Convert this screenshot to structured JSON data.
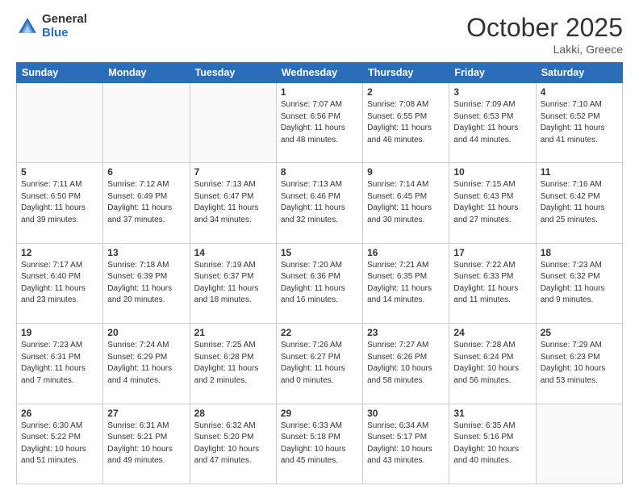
{
  "logo": {
    "general": "General",
    "blue": "Blue"
  },
  "header": {
    "month": "October 2025",
    "location": "Lakki, Greece"
  },
  "weekdays": [
    "Sunday",
    "Monday",
    "Tuesday",
    "Wednesday",
    "Thursday",
    "Friday",
    "Saturday"
  ],
  "weeks": [
    [
      {
        "day": "",
        "info": ""
      },
      {
        "day": "",
        "info": ""
      },
      {
        "day": "",
        "info": ""
      },
      {
        "day": "1",
        "info": "Sunrise: 7:07 AM\nSunset: 6:56 PM\nDaylight: 11 hours and 48 minutes."
      },
      {
        "day": "2",
        "info": "Sunrise: 7:08 AM\nSunset: 6:55 PM\nDaylight: 11 hours and 46 minutes."
      },
      {
        "day": "3",
        "info": "Sunrise: 7:09 AM\nSunset: 6:53 PM\nDaylight: 11 hours and 44 minutes."
      },
      {
        "day": "4",
        "info": "Sunrise: 7:10 AM\nSunset: 6:52 PM\nDaylight: 11 hours and 41 minutes."
      }
    ],
    [
      {
        "day": "5",
        "info": "Sunrise: 7:11 AM\nSunset: 6:50 PM\nDaylight: 11 hours and 39 minutes."
      },
      {
        "day": "6",
        "info": "Sunrise: 7:12 AM\nSunset: 6:49 PM\nDaylight: 11 hours and 37 minutes."
      },
      {
        "day": "7",
        "info": "Sunrise: 7:13 AM\nSunset: 6:47 PM\nDaylight: 11 hours and 34 minutes."
      },
      {
        "day": "8",
        "info": "Sunrise: 7:13 AM\nSunset: 6:46 PM\nDaylight: 11 hours and 32 minutes."
      },
      {
        "day": "9",
        "info": "Sunrise: 7:14 AM\nSunset: 6:45 PM\nDaylight: 11 hours and 30 minutes."
      },
      {
        "day": "10",
        "info": "Sunrise: 7:15 AM\nSunset: 6:43 PM\nDaylight: 11 hours and 27 minutes."
      },
      {
        "day": "11",
        "info": "Sunrise: 7:16 AM\nSunset: 6:42 PM\nDaylight: 11 hours and 25 minutes."
      }
    ],
    [
      {
        "day": "12",
        "info": "Sunrise: 7:17 AM\nSunset: 6:40 PM\nDaylight: 11 hours and 23 minutes."
      },
      {
        "day": "13",
        "info": "Sunrise: 7:18 AM\nSunset: 6:39 PM\nDaylight: 11 hours and 20 minutes."
      },
      {
        "day": "14",
        "info": "Sunrise: 7:19 AM\nSunset: 6:37 PM\nDaylight: 11 hours and 18 minutes."
      },
      {
        "day": "15",
        "info": "Sunrise: 7:20 AM\nSunset: 6:36 PM\nDaylight: 11 hours and 16 minutes."
      },
      {
        "day": "16",
        "info": "Sunrise: 7:21 AM\nSunset: 6:35 PM\nDaylight: 11 hours and 14 minutes."
      },
      {
        "day": "17",
        "info": "Sunrise: 7:22 AM\nSunset: 6:33 PM\nDaylight: 11 hours and 11 minutes."
      },
      {
        "day": "18",
        "info": "Sunrise: 7:23 AM\nSunset: 6:32 PM\nDaylight: 11 hours and 9 minutes."
      }
    ],
    [
      {
        "day": "19",
        "info": "Sunrise: 7:23 AM\nSunset: 6:31 PM\nDaylight: 11 hours and 7 minutes."
      },
      {
        "day": "20",
        "info": "Sunrise: 7:24 AM\nSunset: 6:29 PM\nDaylight: 11 hours and 4 minutes."
      },
      {
        "day": "21",
        "info": "Sunrise: 7:25 AM\nSunset: 6:28 PM\nDaylight: 11 hours and 2 minutes."
      },
      {
        "day": "22",
        "info": "Sunrise: 7:26 AM\nSunset: 6:27 PM\nDaylight: 11 hours and 0 minutes."
      },
      {
        "day": "23",
        "info": "Sunrise: 7:27 AM\nSunset: 6:26 PM\nDaylight: 10 hours and 58 minutes."
      },
      {
        "day": "24",
        "info": "Sunrise: 7:28 AM\nSunset: 6:24 PM\nDaylight: 10 hours and 56 minutes."
      },
      {
        "day": "25",
        "info": "Sunrise: 7:29 AM\nSunset: 6:23 PM\nDaylight: 10 hours and 53 minutes."
      }
    ],
    [
      {
        "day": "26",
        "info": "Sunrise: 6:30 AM\nSunset: 5:22 PM\nDaylight: 10 hours and 51 minutes."
      },
      {
        "day": "27",
        "info": "Sunrise: 6:31 AM\nSunset: 5:21 PM\nDaylight: 10 hours and 49 minutes."
      },
      {
        "day": "28",
        "info": "Sunrise: 6:32 AM\nSunset: 5:20 PM\nDaylight: 10 hours and 47 minutes."
      },
      {
        "day": "29",
        "info": "Sunrise: 6:33 AM\nSunset: 5:18 PM\nDaylight: 10 hours and 45 minutes."
      },
      {
        "day": "30",
        "info": "Sunrise: 6:34 AM\nSunset: 5:17 PM\nDaylight: 10 hours and 43 minutes."
      },
      {
        "day": "31",
        "info": "Sunrise: 6:35 AM\nSunset: 5:16 PM\nDaylight: 10 hours and 40 minutes."
      },
      {
        "day": "",
        "info": ""
      }
    ]
  ]
}
